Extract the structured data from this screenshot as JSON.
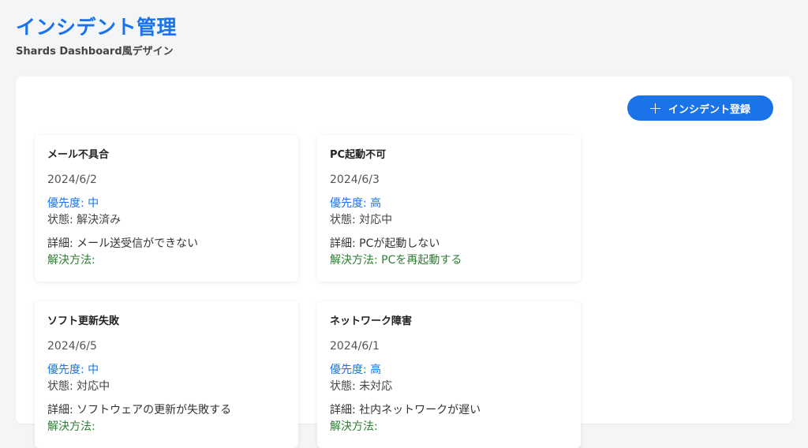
{
  "header": {
    "title": "インシデント管理",
    "subtitle": "Shards Dashboard風デザイン"
  },
  "toolbar": {
    "add_label": "インシデント登録"
  },
  "labels": {
    "priority": "優先度: ",
    "status": "状態: ",
    "detail": "詳細: ",
    "solution": "解決方法: "
  },
  "incidents": [
    {
      "title": "メール不具合",
      "date": "2024/6/2",
      "priority": "中",
      "status": "解決済み",
      "detail": "メール送受信ができない",
      "solution": ""
    },
    {
      "title": "PC起動不可",
      "date": "2024/6/3",
      "priority": "高",
      "status": "対応中",
      "detail": "PCが起動しない",
      "solution": "PCを再起動する"
    },
    {
      "title": "ソフト更新失敗",
      "date": "2024/6/5",
      "priority": "中",
      "status": "対応中",
      "detail": "ソフトウェアの更新が失敗する",
      "solution": ""
    },
    {
      "title": "ネットワーク障害",
      "date": "2024/6/1",
      "priority": "高",
      "status": "未対応",
      "detail": "社内ネットワークが遅い",
      "solution": ""
    }
  ],
  "colors": {
    "accent": "#1a73e8",
    "solution": "#2e7d32",
    "background": "#f4f5f7"
  }
}
